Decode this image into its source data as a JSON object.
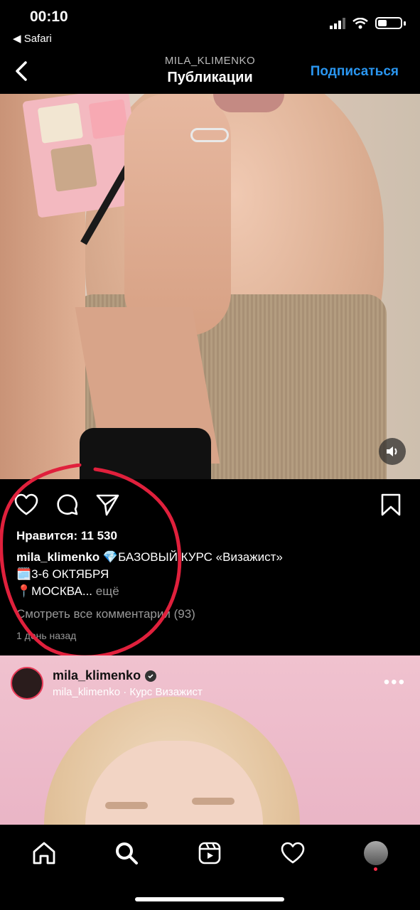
{
  "status_bar": {
    "time": "00:10",
    "back_app": "◀ Safari",
    "icons": [
      "signal-icon",
      "wifi-icon",
      "battery-icon"
    ]
  },
  "nav": {
    "username": "MILA_KLIMENKO",
    "title": "Публикации",
    "follow": "Подписаться",
    "accent_color": "#2a96f0"
  },
  "post1": {
    "likes": "Нравится: 11 530",
    "caption_user": "mila_klimenko",
    "caption_line1": "💎БАЗОВЫЙ КУРС «Визажист»",
    "caption_line2": "🗓️3-6 ОКТЯБРЯ",
    "caption_line3": "📍МОСКВА...",
    "more": "ещё",
    "comments": "Смотреть все комментарии (93)",
    "time_ago": "1 день назад",
    "annotation_color": "#e0203c"
  },
  "post2": {
    "username": "mila_klimenko",
    "subtitle": "mila_klimenko · Курс Визажист"
  },
  "tabbar": {
    "tabs": [
      "home-icon",
      "search-icon",
      "reels-icon",
      "heart-icon",
      "profile-avatar"
    ]
  }
}
